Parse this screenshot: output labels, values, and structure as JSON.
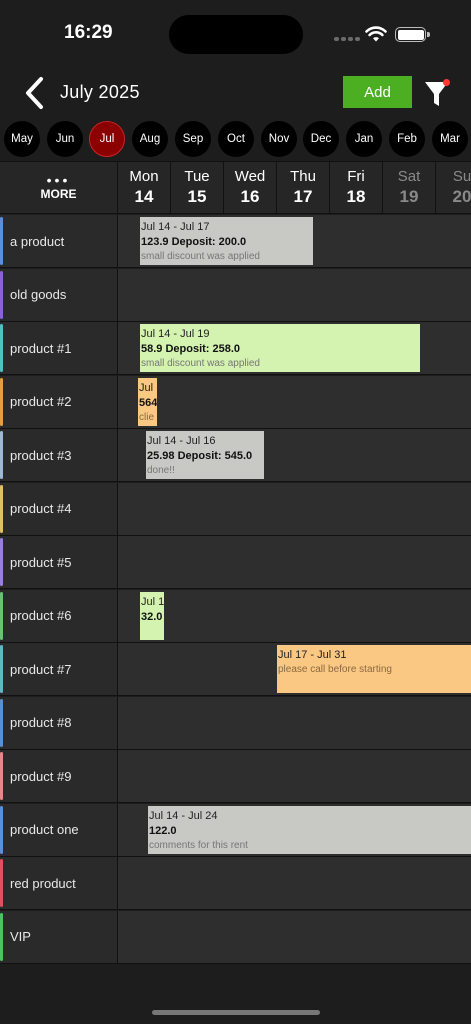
{
  "status_bar": {
    "time": "16:29"
  },
  "header": {
    "title": "July 2025",
    "add_label": "Add"
  },
  "months": [
    "May",
    "Jun",
    "Jul",
    "Aug",
    "Sep",
    "Oct",
    "Nov",
    "Dec",
    "Jan",
    "Feb",
    "Mar"
  ],
  "selected_month": "Jul",
  "grid": {
    "more_label": "MORE",
    "days": [
      {
        "name": "Mon",
        "num": "14",
        "weekend": false
      },
      {
        "name": "Tue",
        "num": "15",
        "weekend": false
      },
      {
        "name": "Wed",
        "num": "16",
        "weekend": false
      },
      {
        "name": "Thu",
        "num": "17",
        "weekend": false
      },
      {
        "name": "Fri",
        "num": "18",
        "weekend": false
      },
      {
        "name": "Sat",
        "num": "19",
        "weekend": true
      },
      {
        "name": "Su",
        "num": "20",
        "weekend": true
      }
    ]
  },
  "rows": [
    {
      "label": "a product",
      "color": "#5b8fd6",
      "booking": {
        "dates": "Jul 14 - Jul 17",
        "amount": "123.9 Deposit: 200.0",
        "comment": "small discount was applied",
        "style": "gray"
      }
    },
    {
      "label": "old goods",
      "color": "#8a63d2",
      "booking": null
    },
    {
      "label": "product #1",
      "color": "#4cc3c3",
      "booking": {
        "dates": "Jul 14 - Jul 19",
        "amount": "58.9 Deposit: 258.0",
        "comment": "small discount was applied",
        "style": "green"
      }
    },
    {
      "label": "product #2",
      "color": "#e0a040",
      "booking": {
        "dates": "Jul",
        "amount": "564",
        "comment": "clie",
        "style": "orange"
      }
    },
    {
      "label": "product #3",
      "color": "#a0b8d8",
      "booking": {
        "dates": "Jul 14 - Jul 16",
        "amount": "25.98 Deposit: 545.0",
        "comment": "done!!",
        "style": "gray"
      }
    },
    {
      "label": "product #4",
      "color": "#e0c060",
      "booking": null
    },
    {
      "label": "product #5",
      "color": "#9a80d8",
      "booking": null
    },
    {
      "label": "product #6",
      "color": "#6cc070",
      "booking": {
        "dates": "Jul 1",
        "amount": "32.0",
        "comment": "",
        "style": "green"
      }
    },
    {
      "label": "product #7",
      "color": "#60b8c0",
      "booking": {
        "dates": "Jul 17 - Jul 31",
        "amount": "",
        "comment": "please call before starting",
        "style": "orange"
      }
    },
    {
      "label": "product #8",
      "color": "#5a90d0",
      "booking": null
    },
    {
      "label": "product #9",
      "color": "#e08a8a",
      "booking": null
    },
    {
      "label": "product one",
      "color": "#5b8fd6",
      "booking": {
        "dates": "Jul 14 - Jul 24",
        "amount": "122.0",
        "comment": "comments for this rent",
        "style": "gray"
      }
    },
    {
      "label": "red product",
      "color": "#e05060",
      "booking": null
    },
    {
      "label": "VIP",
      "color": "#50c060",
      "booking": null
    }
  ],
  "colors": {
    "accent_add": "#4caf22",
    "selected_month": "#8b0000",
    "filter_badge": "#ff3b30"
  },
  "icons": [
    "back-chevron-icon",
    "filter-funnel-icon",
    "wifi-icon",
    "battery-icon",
    "more-dots-icon"
  ]
}
